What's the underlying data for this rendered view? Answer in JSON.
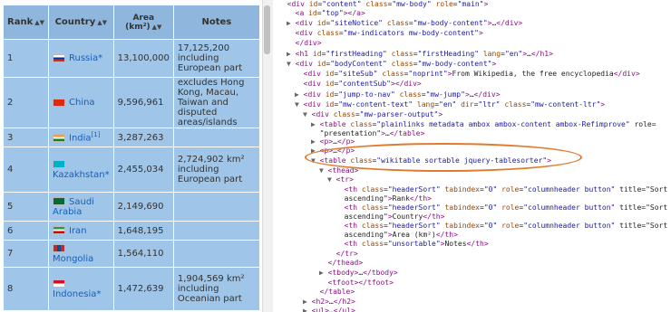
{
  "table": {
    "headers": [
      "Rank",
      "Country",
      "Area\n(km²)",
      "Notes"
    ],
    "rows": [
      {
        "rank": "1",
        "country": "Russia",
        "suffix": "*",
        "area": "13,100,000",
        "notes": "17,125,200 including European part",
        "notes_links": [],
        "flag": "russia"
      },
      {
        "rank": "2",
        "country": "China",
        "suffix": "",
        "area": "9,596,961",
        "notes": "excludes Hong Kong, Macau, Taiwan and disputed areas/islands",
        "flag": "china"
      },
      {
        "rank": "3",
        "country": "India",
        "suffix": "[1]",
        "area": "3,287,263",
        "notes": "",
        "flag": "india"
      },
      {
        "rank": "4",
        "country": "Kazakhstan",
        "suffix": "*",
        "area": "2,455,034",
        "notes": "2,724,902 km² including European part",
        "flag": "kazakhstan"
      },
      {
        "rank": "5",
        "country": "Saudi Arabia",
        "suffix": "",
        "area": "2,149,690",
        "notes": "",
        "flag": "saudi"
      },
      {
        "rank": "6",
        "country": "Iran",
        "suffix": "",
        "area": "1,648,195",
        "notes": "",
        "flag": "iran"
      },
      {
        "rank": "7",
        "country": "Mongolia",
        "suffix": "",
        "area": "1,564,110",
        "notes": "",
        "flag": "mongolia"
      },
      {
        "rank": "8",
        "country": "Indonesia",
        "suffix": "*",
        "area": "1,472,639",
        "notes": "1,904,569 km² including Oceanian part",
        "flag": "indonesia"
      }
    ]
  },
  "devtools": {
    "lines": [
      "<div id=\"content\" class=\"mw-body\" role=\"main\">",
      "<a id=\"top\"></a>",
      "<div id=\"siteNotice\" class=\"mw-body-content\">…</div>",
      "<div class=\"mw-indicators mw-body-content\">",
      "</div>",
      "<h1 id=\"firstHeading\" class=\"firstHeading\" lang=\"en\">…</h1>",
      "<div id=\"bodyContent\" class=\"mw-body-content\">",
      "<div id=\"siteSub\" class=\"noprint\">From Wikipedia, the free encyclopedia</div>",
      "<div id=\"contentSub\"></div>",
      "<div id=\"jump-to-nav\" class=\"mw-jump\">…</div>",
      "<div id=\"mw-content-text\" lang=\"en\" dir=\"ltr\" class=\"mw-content-ltr\">",
      "<div class=\"mw-parser-output\">",
      "<table class=\"plainlinks metadata ambox ambox-content ambox-Refimprove\" role=",
      "\"presentation\">…</table>",
      "<p>…</p>",
      "<p>…</p>",
      "<table class=\"wikitable sortable jquery-tablesorter\">",
      "<thead>",
      "<tr>",
      "<th class=\"headerSort\" tabindex=\"0\" role=\"columnheader button\" title=\"Sort",
      "ascending\">Rank</th>",
      "<th class=\"headerSort\" tabindex=\"0\" role=\"columnheader button\" title=\"Sort",
      "ascending\">Country</th>",
      "<th class=\"headerSort\" tabindex=\"0\" role=\"columnheader button\" title=\"Sort",
      "ascending\">Area (km²)</th>",
      "<th class=\"unsortable\">Notes</th>",
      "</tr>",
      "</thead>",
      "<tbody>…</tbody>",
      "<tfoot></tfoot>",
      "</table>",
      "<h2>…</h2>",
      "<ul>…</ul>"
    ]
  },
  "colors": {
    "highlight": "#9fc5e8",
    "oval": "#e07a2c",
    "tag": "#881280",
    "attr": "#994500",
    "value": "#1a1aa6"
  }
}
